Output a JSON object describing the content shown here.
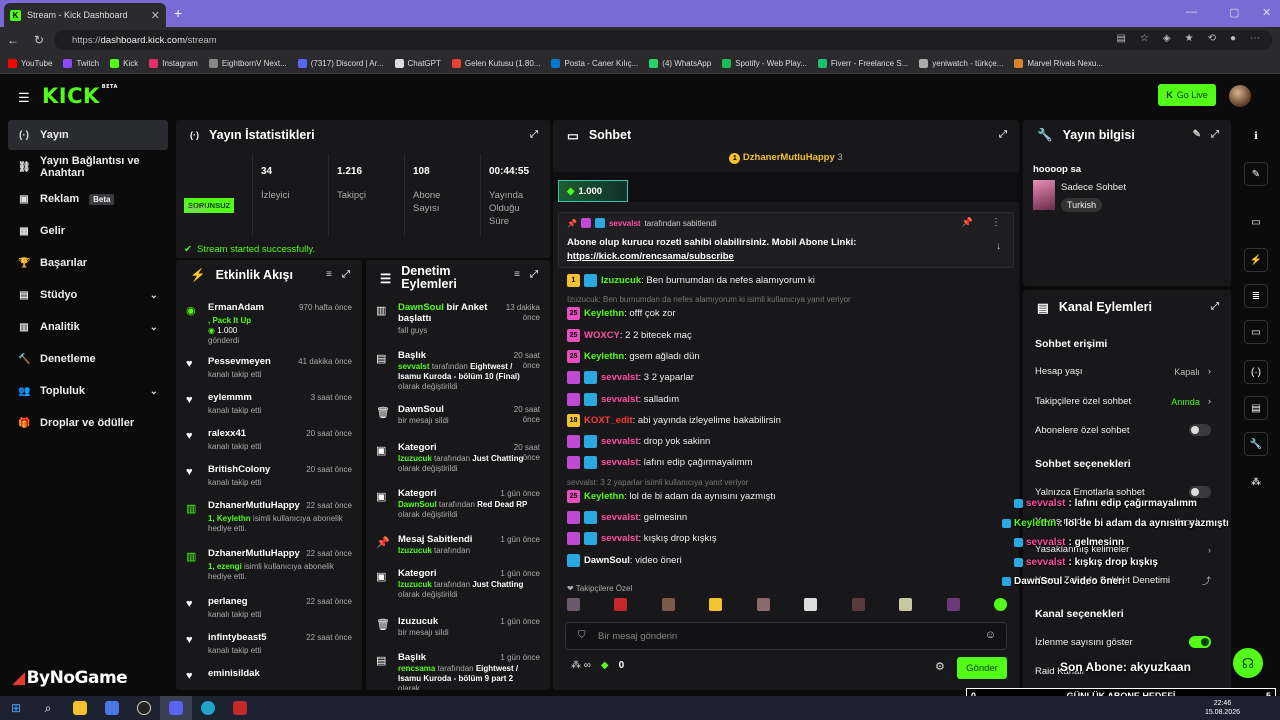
{
  "browser": {
    "tab_title": "Stream - Kick Dashboard",
    "url_prefix": "https://",
    "url_domain": "dashboard.kick.com",
    "url_path": "/stream",
    "bookmarks": [
      {
        "label": "YouTube",
        "color": "#ff0000"
      },
      {
        "label": "Twitch",
        "color": "#9146ff"
      },
      {
        "label": "Kick",
        "color": "#53fc18"
      },
      {
        "label": "Instagram",
        "color": "#e1306c"
      },
      {
        "label": "EightbornV Next...",
        "color": "#888888"
      },
      {
        "label": "(7317) Discord | Ar...",
        "color": "#5865f2"
      },
      {
        "label": "ChatGPT",
        "color": "#dddddd"
      },
      {
        "label": "Gelen Kutusu (1.80...",
        "color": "#ea4335"
      },
      {
        "label": "Posta - Caner Kılıç...",
        "color": "#0078d4"
      },
      {
        "label": "(4) WhatsApp",
        "color": "#25d366"
      },
      {
        "label": "Spotify - Web Play...",
        "color": "#1db954"
      },
      {
        "label": "Fiverr - Freelance S...",
        "color": "#1dbf73"
      },
      {
        "label": "yeniwatch - türkçe...",
        "color": "#aaaaaa"
      },
      {
        "label": "Marvel Rivals Nexu...",
        "color": "#d9822b"
      }
    ]
  },
  "topnav": {
    "logo": "KICK",
    "logo_sup": "BETA",
    "go_live": "Go Live"
  },
  "sidebar": [
    {
      "label": "Yayın",
      "icon": "broadcast-icon",
      "glyph": "(·)",
      "active": true,
      "chev": ""
    },
    {
      "label": "Yayın Bağlantısı ve Anahtarı",
      "icon": "link-icon",
      "glyph": "⛓",
      "active": false,
      "chev": ""
    },
    {
      "label": "Reklam",
      "icon": "ad-icon",
      "glyph": "▣",
      "active": false,
      "chev": "",
      "beta": "Beta"
    },
    {
      "label": "Gelir",
      "icon": "money-icon",
      "glyph": "▦",
      "active": false,
      "chev": ""
    },
    {
      "label": "Başarılar",
      "icon": "trophy-icon",
      "glyph": "🏆",
      "active": false,
      "chev": ""
    },
    {
      "label": "Stüdyo",
      "icon": "studio-icon",
      "glyph": "▤",
      "active": false,
      "chev": "⌄"
    },
    {
      "label": "Analitik",
      "icon": "chart-icon",
      "glyph": "▥",
      "active": false,
      "chev": "⌄"
    },
    {
      "label": "Denetleme",
      "icon": "hammer-icon",
      "glyph": "🔨",
      "active": false,
      "chev": ""
    },
    {
      "label": "Topluluk",
      "icon": "community-icon",
      "glyph": "👥",
      "active": false,
      "chev": "⌄"
    },
    {
      "label": "Droplar ve ödüller",
      "icon": "gift-icon",
      "glyph": "🎁",
      "active": false,
      "chev": ""
    }
  ],
  "stats": {
    "title": "Yayın İstatistikleri",
    "status_badge": "SORUNSUZ",
    "status_label": "Yayın",
    "viewers": "34",
    "viewers_label": "İzleyici",
    "followers": "1.216",
    "followers_label": "Takipçi",
    "subs": "108",
    "subs_label": "Abone Sayısı",
    "uptime": "00:44:55",
    "uptime_label": "Yayında Olduğu Süre",
    "success_msg": "Stream started successfully."
  },
  "activity": {
    "title": "Etkinlik Akışı",
    "items": [
      {
        "name": "ErmanAdam",
        "time": "970 hafta önce",
        "sub1": ", Pack It Up",
        "sub2": "1.000",
        "sub3": "gönderdi",
        "type": "kicks"
      },
      {
        "name": "Pessevmeyen",
        "time": "41 dakika önce",
        "sub1": "kanalı takip etti",
        "type": "follow"
      },
      {
        "name": "eylemmm",
        "time": "3 saat önce",
        "sub1": "kanalı takip etti",
        "type": "follow"
      },
      {
        "name": "ralexx41",
        "time": "20 saat önce",
        "sub1": "kanalı takip etti",
        "type": "follow"
      },
      {
        "name": "BritishColony",
        "time": "20 saat önce",
        "sub1": "kanalı takip etti",
        "type": "follow"
      },
      {
        "name": "DzhanerMutluHappy",
        "time": "22 saat önce",
        "sub_hl": "1, Keylethn",
        "sub1": " isimli kullanıcıya abonelik hediye etti.",
        "type": "gift"
      },
      {
        "name": "DzhanerMutluHappy",
        "time": "22 saat önce",
        "sub_hl": "1, ezengi",
        "sub1": " isimli kullanıcıya abonelik hediye etti.",
        "type": "gift"
      },
      {
        "name": "perlaneg",
        "time": "22 saat önce",
        "sub1": "kanalı takip etti",
        "type": "follow"
      },
      {
        "name": "infintybeast5",
        "time": "22 saat önce",
        "sub1": "kanalı takip etti",
        "type": "follow"
      },
      {
        "name": "eminisildak",
        "time": "",
        "sub1": "",
        "type": "follow"
      }
    ]
  },
  "moderation": {
    "title": "Denetim Eylemleri",
    "items": [
      {
        "title": "DawnSoul bir Anket başlattı",
        "title_hl": "DawnSoul",
        "title_rest": " bir Anket başlattı",
        "time": "13 dakika önce",
        "sub": "fall guys",
        "icon": "poll-icon",
        "glyph": "▥"
      },
      {
        "title": "Başlık",
        "time": "20 saat önce",
        "sub_hl": "sevvalst",
        "sub_mid": " tarafından ",
        "sub_hl2": "Eightwest / Isamu Kuroda - bölüm 10 (Final)",
        "sub_end": " olarak değiştirildi",
        "icon": "title-icon",
        "glyph": "▤"
      },
      {
        "title": "DawnSoul",
        "time": "20 saat önce",
        "sub": "bir mesajı sildi",
        "icon": "trash-icon",
        "glyph": "🗑"
      },
      {
        "title": "Kategori",
        "time": "20 saat önce",
        "sub_hl": "Izuzucuk",
        "sub_mid": " tarafından ",
        "sub_hl2": "Just Chatting",
        "sub_end": " olarak değiştirildi",
        "icon": "category-icon",
        "glyph": "▣"
      },
      {
        "title": "Kategori",
        "time": "1 gün önce",
        "sub_hl": "DawnSoul",
        "sub_mid": " tarafından ",
        "sub_hl2": "Red Dead RP",
        "sub_end": " olarak değiştirildi",
        "icon": "category-icon",
        "glyph": "▣"
      },
      {
        "title": "Mesaj Sabitlendi",
        "time": "1 gün önce",
        "sub_hl": "Izuzucuk",
        "sub_mid": " tarafından",
        "icon": "pin-icon",
        "glyph": "📌"
      },
      {
        "title": "Kategori",
        "time": "1 gün önce",
        "sub_hl": "Izuzucuk",
        "sub_mid": " tarafından ",
        "sub_hl2": "Just Chatting",
        "sub_end": " olarak değiştirildi",
        "icon": "category-icon",
        "glyph": "▣"
      },
      {
        "title": "Izuzucuk",
        "time": "1 gün önce",
        "sub": "bir mesajı sildi",
        "icon": "trash-icon",
        "glyph": "🗑"
      },
      {
        "title": "Başlık",
        "time": "1 gün önce",
        "sub_hl": "rencsama",
        "sub_mid": " tarafından ",
        "sub_hl2": "Eightwest / Isamu Kuroda - bölüm 9 part 2",
        "sub_end": " olarak",
        "icon": "title-icon",
        "glyph": "▤"
      }
    ]
  },
  "chat": {
    "title": "Sohbet",
    "top_gifter": "DzhanerMutluHappy",
    "top_gifter_count": "3",
    "kicks_pill": "1.000",
    "pinned_by": "sevvalst",
    "pinned_label": " tarafından sabitlendi",
    "pinned_text": "Abone olup kurucu rozeti sahibi olabilirsiniz. Mobil Abone Linki:",
    "pinned_link": "https://kick.com/rencsama/subscribe",
    "messages": [
      {
        "badges": [
          "b-gold",
          "b-blue"
        ],
        "badge_txt": "1",
        "name": "Izuzucuk",
        "color": "#53fc18",
        "text": ": Ben burnumdan da nefes alamıyorum ki"
      },
      {
        "reply": "Izuzucuk: Ben burnumdan da nefes alamıyorum ki isimli kullanıcıya yanıt veriyor"
      },
      {
        "badges": [
          "b-pink"
        ],
        "badge_txt": "25",
        "name": "Keylethn",
        "color": "#53fc18",
        "text": ": offf çok zor"
      },
      {
        "badges": [
          "b-pink"
        ],
        "badge_txt": "25",
        "name": "WOXCY",
        "color": "#ff4fa3",
        "text": ": 2 2 bitecek maç"
      },
      {
        "badges": [
          "b-pink"
        ],
        "badge_txt": "25",
        "name": "Keylethn",
        "color": "#53fc18",
        "text": ": gsem ağladı dün"
      },
      {
        "badges": [
          "b-sub",
          "b-blue"
        ],
        "name": "sevvalst",
        "color": "#ff4fa3",
        "text": ": 3 2 yaparlar"
      },
      {
        "badges": [
          "b-sub",
          "b-blue"
        ],
        "name": "sevvalst",
        "color": "#ff4fa3",
        "text": ": salladım"
      },
      {
        "badges": [
          "b-gold"
        ],
        "badge_txt": "18",
        "name": "KOXT_edit",
        "color": "#ff3b3b",
        "text": ": abi yayında izleyelime bakabilirsin"
      },
      {
        "badges": [
          "b-sub",
          "b-blue"
        ],
        "name": "sevvalst",
        "color": "#ff4fa3",
        "text": ": drop yok sakinn"
      },
      {
        "badges": [
          "b-sub",
          "b-blue"
        ],
        "name": "sevvalst",
        "color": "#ff4fa3",
        "text": ": lafını edip çağırmayalımm"
      },
      {
        "reply": "sevvalst: 3 2 yaparlar isimli kullanıcıya yanıt veriyor"
      },
      {
        "badges": [
          "b-pink"
        ],
        "badge_txt": "25",
        "name": "Keylethn",
        "color": "#53fc18",
        "text": ": lol de bi adam da aynısını yazmıştı"
      },
      {
        "badges": [
          "b-sub",
          "b-blue"
        ],
        "name": "sevvalst",
        "color": "#ff4fa3",
        "text": ": gelmesinn"
      },
      {
        "badges": [
          "b-sub",
          "b-blue"
        ],
        "name": "sevvalst",
        "color": "#ff4fa3",
        "text": ": kışkış drop kışkış"
      },
      {
        "badges": [
          "b-blue"
        ],
        "name": "DawnSoul",
        "color": "#ffffff",
        "text": ": video öneri"
      }
    ],
    "followers_label": "Takipçilere Özel",
    "input_placeholder": "Bir mesaj gönderin",
    "kicks_count": "0",
    "send": "Gönder"
  },
  "stream_info": {
    "title": "Yayın bilgisi",
    "stream_title": "hoooop sa",
    "category": "Sadece Sohbet",
    "tag": "Turkish"
  },
  "channel_actions": {
    "title": "Kanal Eylemleri",
    "chat_access": "Sohbet erişimi",
    "account_age": "Hesap yaşı",
    "account_age_val": "Kapalı",
    "followers_only": "Takipçilere özel sohbet",
    "followers_only_val": "Anında",
    "subs_only": "Abonelere özel sohbet",
    "chat_options": "Sohbet seçenekleri",
    "emote_only": "Yalnızca Emotlarla sohbet",
    "slow_mode": "Yavaş mod",
    "slow_mode_val": "Kapalı",
    "banned_words": "Yasaklanmış kelimeler",
    "auto_mod": "Yapay Zekayla Sohbet Denetimi",
    "channel_options": "Kanal seçenekleri",
    "show_viewers": "İzlenme sayısını göster",
    "raid": "Raid Kanalı"
  },
  "overlay": {
    "messages": [
      {
        "name": "sevvalst",
        "text": " : lafını edip çağırmayalımm",
        "color": "#ff4fa3"
      },
      {
        "name": "Keylethn",
        "text": " : lol de bi adam da aynısını yazmıştı",
        "color": "#53fc18"
      },
      {
        "name": "sevvalst",
        "text": " : gelmesinn",
        "color": "#ff4fa3"
      },
      {
        "name": "sevvalst",
        "text": " : kışkış drop kışkış",
        "color": "#ff4fa3"
      },
      {
        "name": "DawnSoul",
        "text": " : video öneri",
        "color": "#ffffff"
      }
    ],
    "last_sub": "Son Abone: akyuzkaan",
    "goal_label": "GÜNLÜK ABONE HEDEFİ",
    "goal_current": "0",
    "goal_target": "5",
    "watermark": "ByNoGame"
  },
  "taskbar": {
    "time": "22:46",
    "date": "15.08.2026"
  },
  "colors": {
    "accent": "#53fc18",
    "panel": "#18181a",
    "bg": "#0b0b0c"
  }
}
